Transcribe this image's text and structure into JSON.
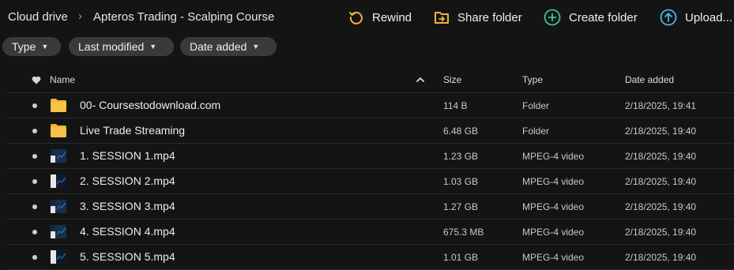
{
  "breadcrumb": [
    "Cloud drive",
    "Apteros Trading - Scalping Course"
  ],
  "breadcrumb_separator": "›",
  "toolbar": {
    "rewind": "Rewind",
    "share_folder": "Share folder",
    "create_folder": "Create folder",
    "upload": "Upload..."
  },
  "filters": [
    "Type",
    "Last modified",
    "Date added"
  ],
  "columns": {
    "name": "Name",
    "size": "Size",
    "type": "Type",
    "date_added": "Date added"
  },
  "rows": [
    {
      "name": "00- Coursestodownload.com",
      "size": "114 B",
      "type": "Folder",
      "date": "2/18/2025, 19:41",
      "icon": "folder-icon"
    },
    {
      "name": "Live Trade Streaming",
      "size": "6.48 GB",
      "type": "Folder",
      "date": "2/18/2025, 19:40",
      "icon": "folder-icon"
    },
    {
      "name": "1. SESSION 1.mp4",
      "size": "1.23 GB",
      "type": "MPEG-4 video",
      "date": "2/18/2025, 19:40",
      "icon": "video-thumbnail-icon"
    },
    {
      "name": "2. SESSION 2.mp4",
      "size": "1.03 GB",
      "type": "MPEG-4 video",
      "date": "2/18/2025, 19:40",
      "icon": "video-thumbnail-icon"
    },
    {
      "name": "3. SESSION 3.mp4",
      "size": "1.27 GB",
      "type": "MPEG-4 video",
      "date": "2/18/2025, 19:40",
      "icon": "video-thumbnail-icon"
    },
    {
      "name": "4. SESSION 4.mp4",
      "size": "675.3 MB",
      "type": "MPEG-4 video",
      "date": "2/18/2025, 19:40",
      "icon": "video-thumbnail-icon"
    },
    {
      "name": "5. SESSION 5.mp4",
      "size": "1.01 GB",
      "type": "MPEG-4 video",
      "date": "2/18/2025, 19:40",
      "icon": "video-thumbnail-icon"
    }
  ],
  "colors": {
    "background": "#141414",
    "chip": "#3a3a3a",
    "rewind_icon": "#f2b33d",
    "share_icon": "#f2b33d",
    "create_icon": "#43c08e",
    "upload_icon": "#4fb3e8",
    "folder": "#f5b52e"
  }
}
